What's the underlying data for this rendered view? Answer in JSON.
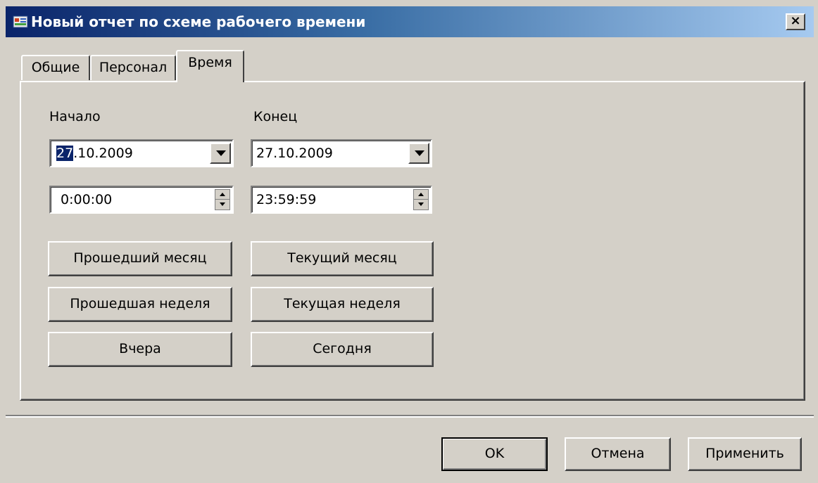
{
  "window": {
    "title": "Новый отчет по схеме рабочего времени",
    "close_label": "×"
  },
  "tabs": [
    {
      "label": "Общие",
      "active": false
    },
    {
      "label": "Персонал",
      "active": false
    },
    {
      "label": "Время",
      "active": true
    }
  ],
  "time_tab": {
    "start_label": "Начало",
    "end_label": "Конец",
    "start_date": {
      "selected_part": "27",
      "rest": ".10.2009"
    },
    "end_date": "27.10.2009",
    "start_time": "0:00:00",
    "end_time": "23:59:59",
    "buttons": {
      "last_month": "Прошедший месяц",
      "current_month": "Текущий месяц",
      "last_week": "Прошедшая неделя",
      "current_week": "Текущая неделя",
      "yesterday": "Вчера",
      "today": "Сегодня"
    }
  },
  "footer": {
    "ok": "OK",
    "cancel": "Отмена",
    "apply": "Применить"
  },
  "colors": {
    "titlebar_start": "#0a246a",
    "titlebar_end": "#a6caf0",
    "face": "#d4d0c8",
    "selection": "#0a246a"
  },
  "icons": {
    "app": "app-icon",
    "close": "close-icon",
    "dropdown": "chevron-down-icon",
    "spin": "spin-arrows-icon"
  }
}
